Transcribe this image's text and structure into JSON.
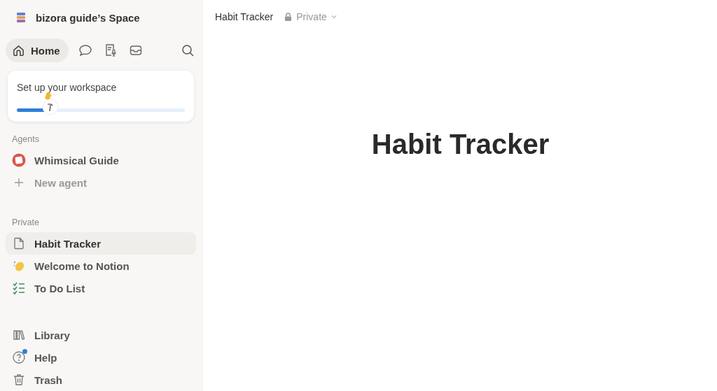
{
  "sidebar": {
    "workspace": "bizora guide’s Space",
    "nav": [
      {
        "kind": "home",
        "label": "Home",
        "selected": true
      },
      {
        "kind": "chat",
        "selected": false
      },
      {
        "kind": "meeting",
        "selected": false
      },
      {
        "kind": "inbox",
        "selected": false
      },
      {
        "kind": "search",
        "selected": false
      }
    ],
    "setup": {
      "title": "Set up your workspace",
      "level": 0.2
    },
    "agents": {
      "heading": "Agents",
      "items": [
        {
          "kind": "agent",
          "label": "Whimsical Guide"
        },
        {
          "kind": "add",
          "label": "New agent"
        }
      ]
    },
    "private": {
      "heading": "Private",
      "items": [
        {
          "kind": "page",
          "label": "Habit Tracker",
          "selected": true
        },
        {
          "kind": "wave",
          "label": "Welcome to Notion",
          "selected": false
        },
        {
          "kind": "checklist",
          "label": "To Do List",
          "selected": false
        }
      ]
    },
    "footer": [
      {
        "kind": "library",
        "label": "Library",
        "badge": false
      },
      {
        "kind": "help",
        "label": "Help",
        "badge": true
      },
      {
        "kind": "trash",
        "label": "Trash",
        "badge": false
      }
    ]
  },
  "topbar": {
    "breadcrumb": "Habit Tracker",
    "visibility": "Private"
  },
  "page": {
    "title": "Habit Tracker"
  }
}
